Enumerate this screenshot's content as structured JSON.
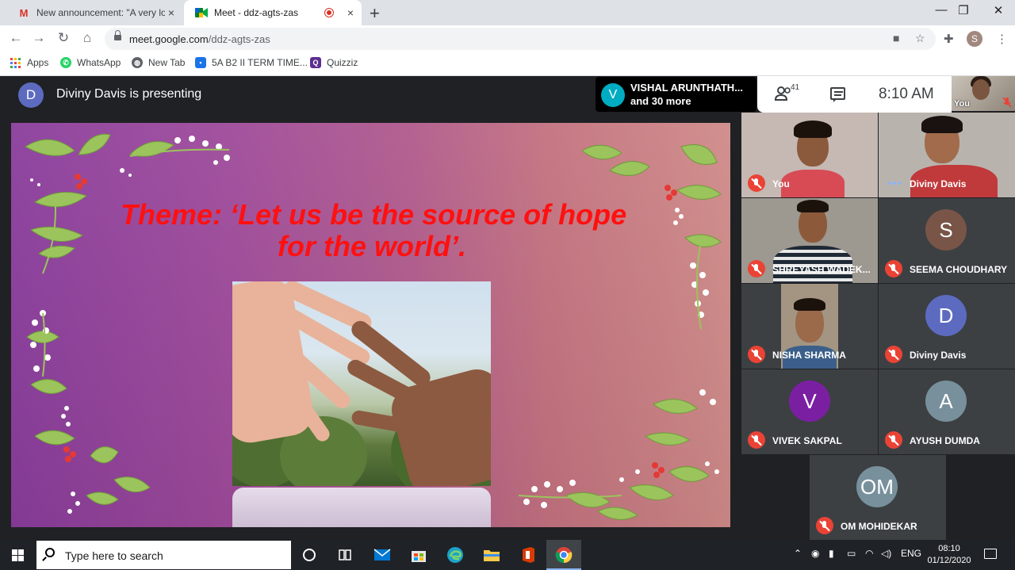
{
  "browser": {
    "tabs": [
      {
        "title": "New announcement: \"A very love",
        "close": "×"
      },
      {
        "title": "Meet - ddz-agts-zas",
        "close": "×"
      }
    ],
    "new_tab": "+",
    "window_controls": {
      "minimize": "—",
      "maximize": "❐",
      "close": "✕"
    },
    "url_host": "meet.google.com",
    "url_path": "/ddz-agts-zas",
    "profile_initial": "S",
    "bookmarks": [
      "Apps",
      "WhatsApp",
      "New Tab",
      "5A B2 II TERM TIME...",
      "Quizziz"
    ]
  },
  "meet": {
    "presenter_initial": "D",
    "presenter_text": "Diviny Davis is presenting",
    "active_speaker": {
      "initial": "V",
      "name": "VISHAL ARUNTHATH...",
      "more": "and 30 more"
    },
    "participant_count": "41",
    "time": "8:10 AM",
    "self_label": "You",
    "slide": {
      "theme_word": "Theme",
      "theme_colon": ": ‘",
      "theme_line1": "Let us be the source of hope",
      "theme_line2": "for the world",
      "theme_end": "’."
    },
    "participants": [
      {
        "name": "You",
        "muted": true
      },
      {
        "name": "Diviny Davis",
        "muted": false
      },
      {
        "name": "SHREYASH WADEK...",
        "muted": true
      },
      {
        "name": "SEEMA CHOUDHARY",
        "initial": "S",
        "color": "#795548",
        "muted": true
      },
      {
        "name": "NISHA SHARMA",
        "muted": true
      },
      {
        "name": "Diviny Davis",
        "initial": "D",
        "color": "#5c6bc0",
        "muted": true
      },
      {
        "name": "VIVEK SAKPAL",
        "initial": "V",
        "color": "#7b1fa2",
        "muted": true
      },
      {
        "name": "AYUSH DUMDA",
        "initial": "A",
        "color": "#78909c",
        "muted": true
      },
      {
        "name": "OM MOHIDEKAR",
        "initial": "OM",
        "color": "#78909c",
        "muted": true
      }
    ]
  },
  "taskbar": {
    "search_placeholder": "Type here to search",
    "lang": "ENG",
    "time": "08:10",
    "date": "01/12/2020"
  }
}
